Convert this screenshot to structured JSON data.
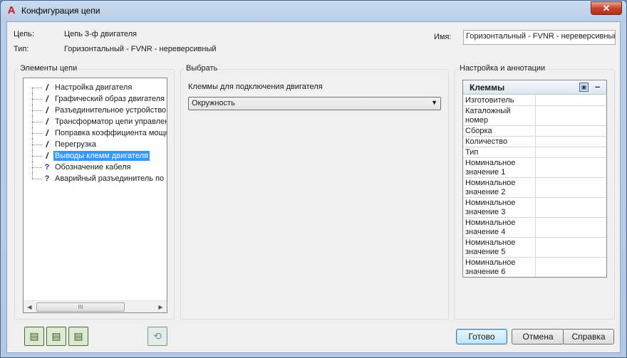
{
  "window": {
    "title": "Конфигурация цепи",
    "close_label": "✕"
  },
  "header": {
    "circuit_label": "Цепь:",
    "circuit_value": "Цепь 3-ф двигателя",
    "type_label": "Тип:",
    "type_value": "Горизонтальный - FVNR - нереверсивный",
    "name_label": "Имя:",
    "name_value": "Горизонтальный - FVNR - нереверсивный"
  },
  "elements_group": {
    "title": "Элементы цепи",
    "items": [
      {
        "label": "Настройка двигателя",
        "icon": "pencil-icon",
        "selected": false
      },
      {
        "label": "Графический образ двигателя",
        "icon": "pencil-icon",
        "selected": false
      },
      {
        "label": "Разъединительное устройство",
        "icon": "pencil-icon",
        "selected": false
      },
      {
        "label": "Трансформатор цепи управления",
        "icon": "pencil-icon",
        "selected": false
      },
      {
        "label": "Поправка коэффициента мощности",
        "icon": "pencil-icon",
        "selected": false
      },
      {
        "label": "Перегрузка",
        "icon": "pencil-icon",
        "selected": false
      },
      {
        "label": "Выводы клемм двигателя",
        "icon": "pencil-icon",
        "selected": true
      },
      {
        "label": "Обозначение кабеля",
        "icon": "question-icon",
        "selected": false
      },
      {
        "label": "Аварийный разъединитель по",
        "icon": "question-icon",
        "selected": false
      }
    ],
    "scroll_thumb_label": "III"
  },
  "select_group": {
    "title": "Выбрать",
    "field_label": "Клеммы для подключения двигателя",
    "selected_value": "Окружность"
  },
  "annotations_group": {
    "title": "Настройка и аннотации",
    "table_title": "Клеммы",
    "rows": [
      "Изготовитель",
      "Каталожный номер",
      "Сборка",
      "Количество",
      "Тип",
      "Номинальное значение 1",
      "Номинальное значение 2",
      "Номинальное значение 3",
      "Номинальное значение 4",
      "Номинальное значение 5",
      "Номинальное значение 6"
    ]
  },
  "buttons": {
    "ok": "Готово",
    "cancel": "Отмена",
    "help": "Справка"
  },
  "colors": {
    "selection": "#3399ff",
    "question_mark": "#1c2f9c",
    "close_button": "#c7432d"
  }
}
